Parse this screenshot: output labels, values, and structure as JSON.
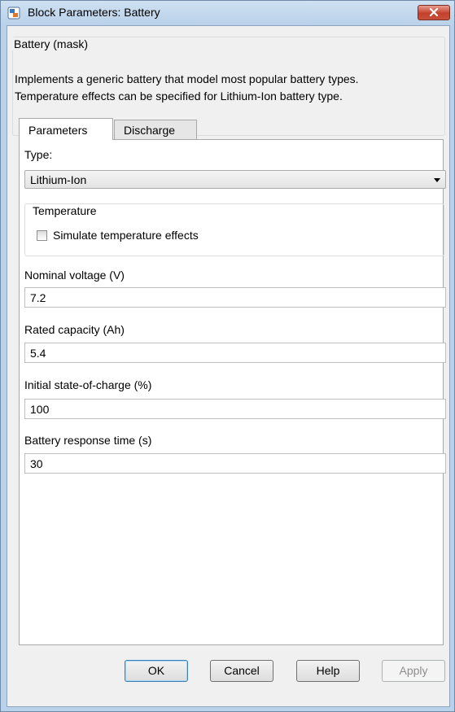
{
  "window": {
    "title": "Block Parameters: Battery"
  },
  "mask": {
    "legend": "Battery (mask)",
    "description_line1": "Implements a generic battery that model most popular battery types.",
    "description_line2": "Temperature effects can be specified for Lithium-Ion battery type."
  },
  "tabs": [
    {
      "label": "Parameters",
      "active": true
    },
    {
      "label": "Discharge",
      "active": false
    }
  ],
  "parameters": {
    "type_label": "Type:",
    "type_value": "Lithium-Ion",
    "temperature_legend": "Temperature",
    "simulate_temp_label": "Simulate temperature effects",
    "simulate_temp_checked": false,
    "nominal_voltage_label": "Nominal voltage (V)",
    "nominal_voltage_value": "7.2",
    "rated_capacity_label": "Rated capacity (Ah)",
    "rated_capacity_value": "5.4",
    "initial_soc_label": "Initial state-of-charge (%)",
    "initial_soc_value": "100",
    "response_time_label": "Battery response time (s)",
    "response_time_value": "30"
  },
  "buttons": {
    "ok": "OK",
    "cancel": "Cancel",
    "help": "Help",
    "apply": "Apply"
  },
  "colors": {
    "titlebar": "#b9d1ea",
    "close_button": "#c7503c",
    "dialog_background": "#f0f0f0"
  }
}
